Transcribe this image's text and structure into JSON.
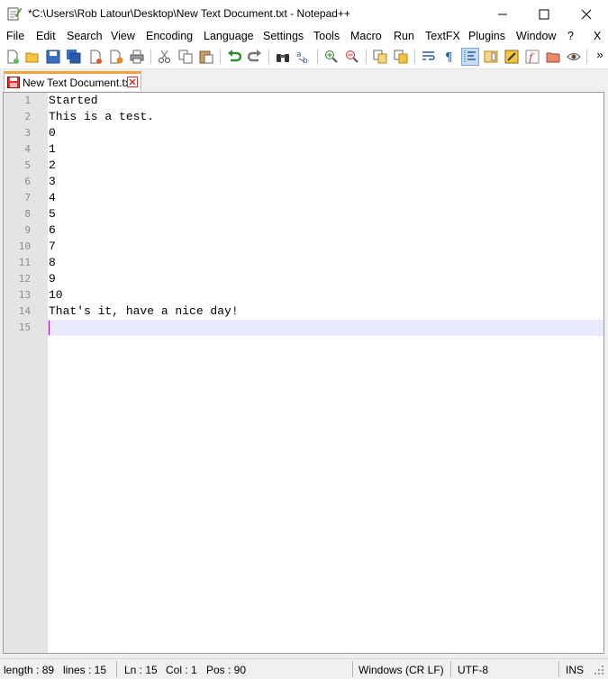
{
  "window": {
    "title": "*C:\\Users\\Rob Latour\\Desktop\\New Text Document.txt - Notepad++",
    "app_icon": "notepad-plus-plus-icon"
  },
  "menu": {
    "items": [
      "File",
      "Edit",
      "Search",
      "View",
      "Encoding",
      "Language",
      "Settings",
      "Tools",
      "Macro",
      "Run",
      "TextFX",
      "Plugins",
      "Window",
      "?"
    ],
    "close_label": "X"
  },
  "toolbar": {
    "buttons": [
      "new-file",
      "open-file",
      "save",
      "save-all",
      "close",
      "close-all",
      "print",
      "cut",
      "copy",
      "paste",
      "undo",
      "redo",
      "find",
      "replace",
      "zoom-in",
      "zoom-out",
      "sync-vertical",
      "sync-horizontal",
      "word-wrap",
      "show-all-characters",
      "indent-guide",
      "document-map",
      "function-list",
      "folder-as-workspace",
      "monitoring"
    ],
    "overflow_label": "»"
  },
  "tabs": [
    {
      "label": "New Text Document.txt",
      "modified": true,
      "active": true
    }
  ],
  "editor": {
    "lines": [
      "Started",
      "This is a test.",
      "0",
      "1",
      "2",
      "3",
      "4",
      "5",
      "6",
      "7",
      "8",
      "9",
      "10",
      "That's it, have a nice day!",
      ""
    ],
    "line_numbers": [
      "1",
      "2",
      "3",
      "4",
      "5",
      "6",
      "7",
      "8",
      "9",
      "10",
      "11",
      "12",
      "13",
      "14",
      "15"
    ],
    "current_line": 15
  },
  "status": {
    "length": "length : 89",
    "lines": "lines : 15",
    "ln": "Ln : 15",
    "col": "Col : 1",
    "pos": "Pos : 90",
    "eol": "Windows (CR LF)",
    "encoding": "UTF-8",
    "mode": "INS"
  },
  "colors": {
    "tab_accent": "#f4a33b",
    "current_line": "#e8e8ff",
    "caret": "#8000ff",
    "gutter": "#e4e4e4"
  }
}
